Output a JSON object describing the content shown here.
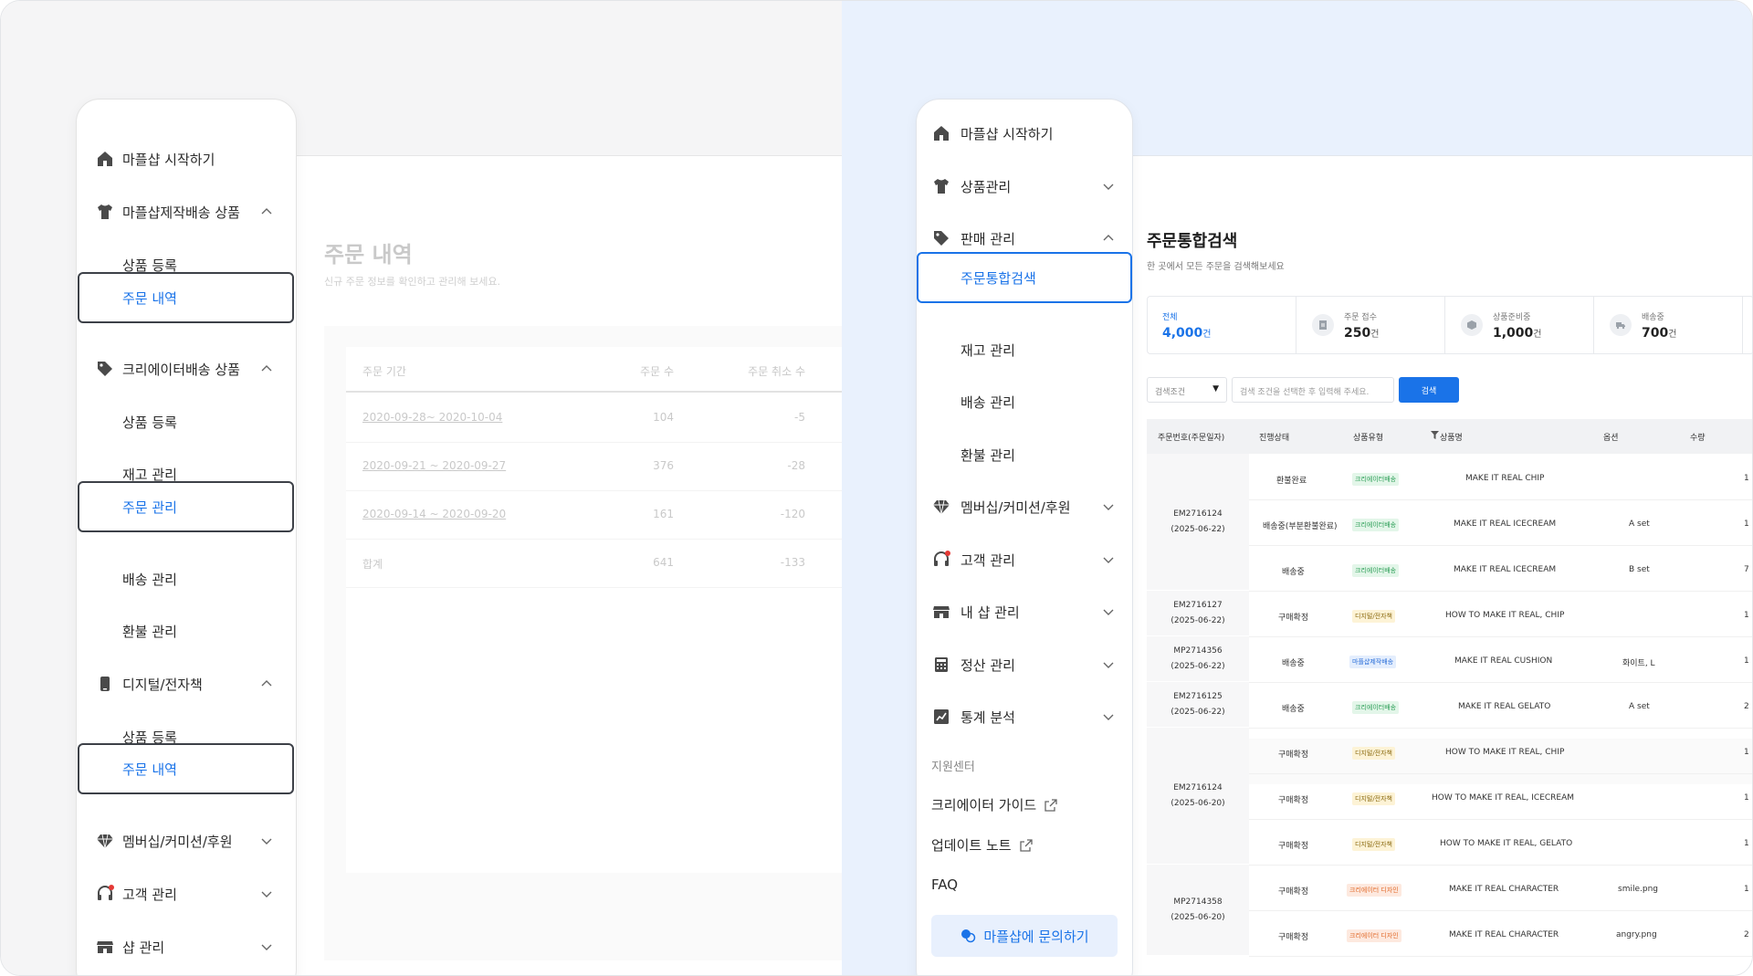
{
  "left": {
    "sidebar": {
      "items": [
        {
          "label": "마플샵 시작하기"
        },
        {
          "label": "마플샵제작배송 상품"
        },
        {
          "label": "상품 등록"
        },
        {
          "label": "주문 내역"
        },
        {
          "label": "크리에이터배송 상품"
        },
        {
          "label": "상품 등록"
        },
        {
          "label": "재고 관리"
        },
        {
          "label": "주문 관리"
        },
        {
          "label": "배송 관리"
        },
        {
          "label": "환불 관리"
        },
        {
          "label": "디지털/전자책"
        },
        {
          "label": "상품 등록"
        },
        {
          "label": "주문 내역"
        },
        {
          "label": "멤버십/커미션/후원"
        },
        {
          "label": "고객 관리"
        },
        {
          "label": "샵 관리"
        }
      ]
    },
    "main": {
      "title": "주문 내역",
      "subtitle": "신규 주문 정보를 확인하고 관리해 보세요.",
      "columns": [
        "주문 기간",
        "주문 수",
        "주문 취소 수"
      ],
      "rows": [
        {
          "period": "2020-09-28~ 2020-10-04",
          "orders": "104",
          "cancels": "-5"
        },
        {
          "period": "2020-09-21 ~ 2020-09-27",
          "orders": "376",
          "cancels": "-28"
        },
        {
          "period": "2020-09-14 ~ 2020-09-20",
          "orders": "161",
          "cancels": "-120"
        },
        {
          "period": "합계",
          "orders": "641",
          "cancels": "-133"
        }
      ]
    }
  },
  "right": {
    "sidebar": {
      "items": [
        {
          "label": "마플샵 시작하기"
        },
        {
          "label": "상품관리"
        },
        {
          "label": "판매 관리"
        },
        {
          "label": "주문통합검색"
        },
        {
          "label": "재고 관리"
        },
        {
          "label": "배송 관리"
        },
        {
          "label": "환불 관리"
        },
        {
          "label": "멤버십/커미션/후원"
        },
        {
          "label": "고객 관리"
        },
        {
          "label": "내 샵 관리"
        },
        {
          "label": "정산 관리"
        },
        {
          "label": "통계 분석"
        }
      ],
      "support": {
        "title": "지원센터",
        "guide": "크리에이터 가이드",
        "update": "업데이트 노트",
        "faq": "FAQ",
        "contact": "마플샵에 문의하기"
      }
    },
    "main": {
      "title": "주문통합검색",
      "subtitle": "한 곳에서 모든 주문을 검색해보세요",
      "stats": [
        {
          "label": "전체",
          "value": "4,000",
          "unit": "건"
        },
        {
          "label": "주문 접수",
          "value": "250",
          "unit": "건"
        },
        {
          "label": "상품준비중",
          "value": "1,000",
          "unit": "건"
        },
        {
          "label": "배송중",
          "value": "700",
          "unit": "건"
        }
      ],
      "search": {
        "select": "검색조건",
        "placeholder": "검색 조건을 선택한 후 입력해 주세요.",
        "button": "검색"
      },
      "columns": [
        "주문번호(주문일자)",
        "진행상태",
        "상품유형",
        "상품명",
        "옵션",
        "수량"
      ],
      "orders": [
        {
          "no": "EM2716124",
          "date": "(2025-06-22)"
        },
        {
          "no": "EM2716127",
          "date": "(2025-06-22)"
        },
        {
          "no": "MP2714356",
          "date": "(2025-06-22)"
        },
        {
          "no": "EM2716125",
          "date": "(2025-06-22)"
        },
        {
          "no": "EM2716124",
          "date": "(2025-06-20)"
        },
        {
          "no": "MP2714358",
          "date": "(2025-06-20)"
        }
      ],
      "rows": [
        {
          "status": "환불완료",
          "type": "크리에이터배송",
          "name": "MAKE IT REAL CHIP",
          "option": "",
          "qty": "1"
        },
        {
          "status": "배송중(부분환불완료)",
          "type": "크리에이터배송",
          "name": "MAKE IT REAL ICECREAM",
          "option": "A set",
          "qty": "1"
        },
        {
          "status": "배송중",
          "type": "크리에이터배송",
          "name": "MAKE IT REAL ICECREAM",
          "option": "B set",
          "qty": "7"
        },
        {
          "status": "구매확정",
          "type": "디지털/전자책",
          "name": "HOW TO MAKE IT REAL, CHIP",
          "option": "",
          "qty": "1"
        },
        {
          "status": "배송중",
          "type": "마플샵제작배송",
          "name": "MAKE IT REAL CUSHION",
          "option": "화이트, L",
          "qty": "1"
        },
        {
          "status": "배송중",
          "type": "크리에이터배송",
          "name": "MAKE IT REAL GELATO",
          "option": "A set",
          "qty": "2"
        },
        {
          "status": "구매확정",
          "type": "디지털/전자책",
          "name": "HOW TO MAKE IT REAL, CHIP",
          "option": "",
          "qty": "1"
        },
        {
          "status": "구매확정",
          "type": "디지털/전자책",
          "name": "HOW TO MAKE IT REAL, ICECREAM",
          "option": "",
          "qty": "1"
        },
        {
          "status": "구매확정",
          "type": "디지털/전자책",
          "name": "HOW TO MAKE IT REAL, GELATO",
          "option": "",
          "qty": "1"
        },
        {
          "status": "구매확정",
          "type": "크리에이터 디자인",
          "name": "MAKE IT REAL CHARACTER",
          "option": "smile.png",
          "qty": "1"
        },
        {
          "status": "구매확정",
          "type": "크리에이터 디자인",
          "name": "MAKE IT REAL CHARACTER",
          "option": "angry.png",
          "qty": "2"
        }
      ]
    }
  },
  "colors": {
    "accent": "#1a73e8",
    "left_bg": "#f5f5f6",
    "right_bg": "#e9f1fd"
  }
}
